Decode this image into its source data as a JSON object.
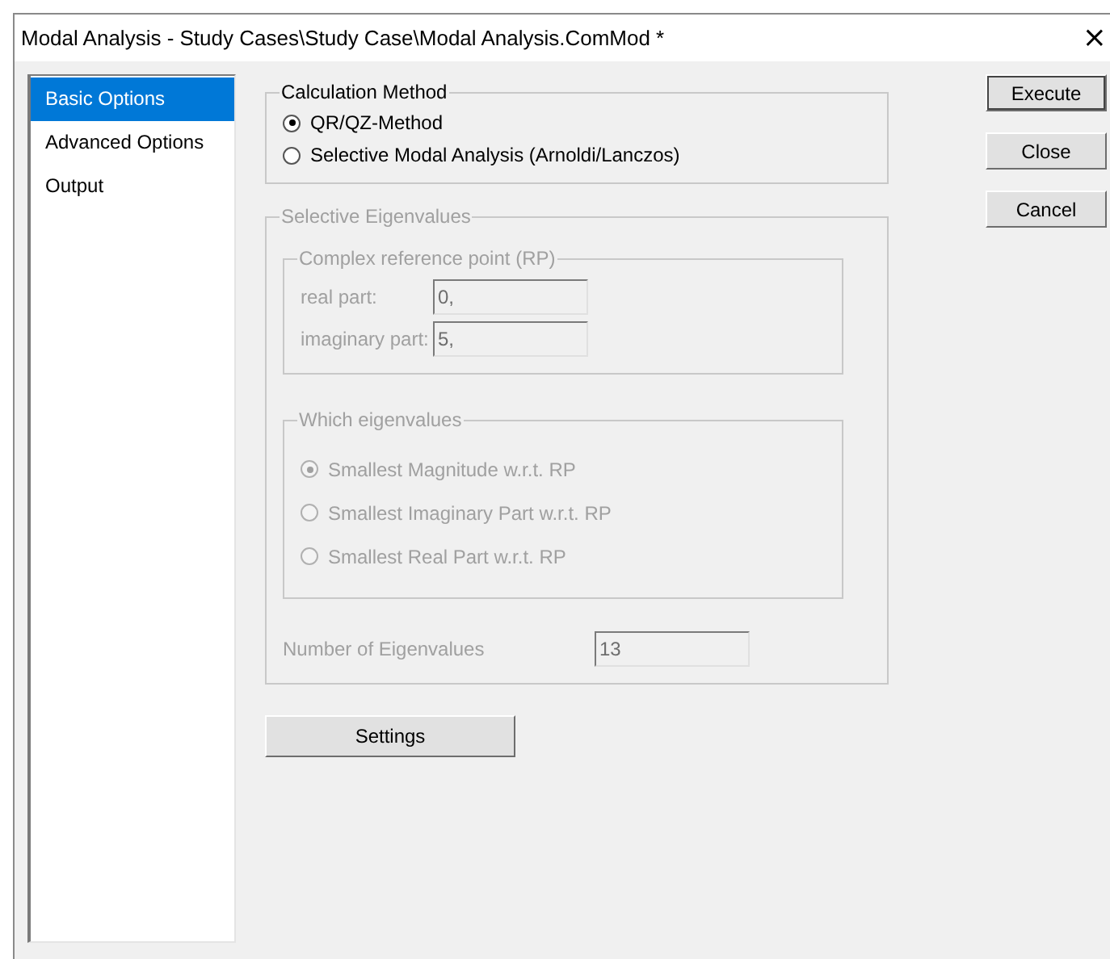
{
  "window": {
    "title": "Modal Analysis - Study Cases\\Study Case\\Modal Analysis.ComMod *",
    "close": "×"
  },
  "sidebar": {
    "items": [
      {
        "label": "Basic Options",
        "selected": true
      },
      {
        "label": "Advanced Options",
        "selected": false
      },
      {
        "label": "Output",
        "selected": false
      }
    ]
  },
  "calculation_method": {
    "title": "Calculation Method",
    "options": [
      {
        "label": "QR/QZ-Method",
        "selected": true
      },
      {
        "label": "Selective Modal Analysis (Arnoldi/Lanczos)",
        "selected": false
      }
    ]
  },
  "selective_eigenvalues": {
    "title": "Selective Eigenvalues",
    "disabled": true,
    "reference_point": {
      "title": "Complex reference point (RP)",
      "fields": [
        {
          "label": "real part:",
          "value": "0,"
        },
        {
          "label": "imaginary part:",
          "value": "5,"
        }
      ]
    },
    "which": {
      "title": "Which eigenvalues",
      "options": [
        {
          "label": "Smallest Magnitude w.r.t. RP",
          "selected": true
        },
        {
          "label": "Smallest Imaginary Part w.r.t. RP",
          "selected": false
        },
        {
          "label": "Smallest Real Part w.r.t. RP",
          "selected": false
        }
      ]
    },
    "count": {
      "label": "Number of Eigenvalues",
      "value": "13"
    }
  },
  "settings_button": "Settings",
  "buttons": [
    "Execute",
    "Close",
    "Cancel"
  ]
}
